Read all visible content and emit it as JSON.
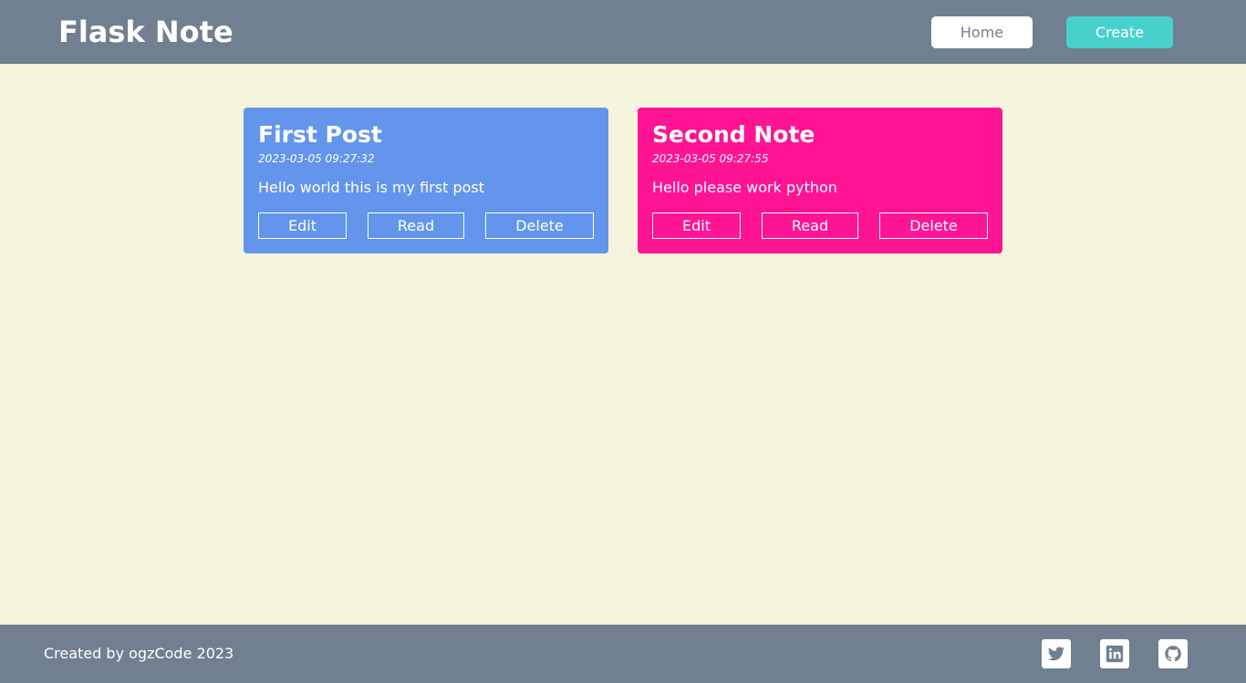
{
  "header": {
    "brand": "Flask Note",
    "nav": {
      "home_label": "Home",
      "create_label": "Create"
    }
  },
  "notes": [
    {
      "title": "First Post",
      "date": "2023-03-05 09:27:32",
      "body": "Hello world this is my first post",
      "color": "#6495ed",
      "edit_label": "Edit",
      "read_label": "Read",
      "delete_label": "Delete"
    },
    {
      "title": "Second Note",
      "date": "2023-03-05 09:27:55",
      "body": "Hello please work python",
      "color": "#ff1493",
      "edit_label": "Edit",
      "read_label": "Read",
      "delete_label": "Delete"
    }
  ],
  "footer": {
    "credit": "Created by ogzCode 2023",
    "social": [
      "twitter-icon",
      "linkedin-icon",
      "github-icon"
    ]
  },
  "colors": {
    "header_bg": "#708090",
    "page_bg": "#f5f4dc",
    "create_accent": "#48d1cc"
  }
}
